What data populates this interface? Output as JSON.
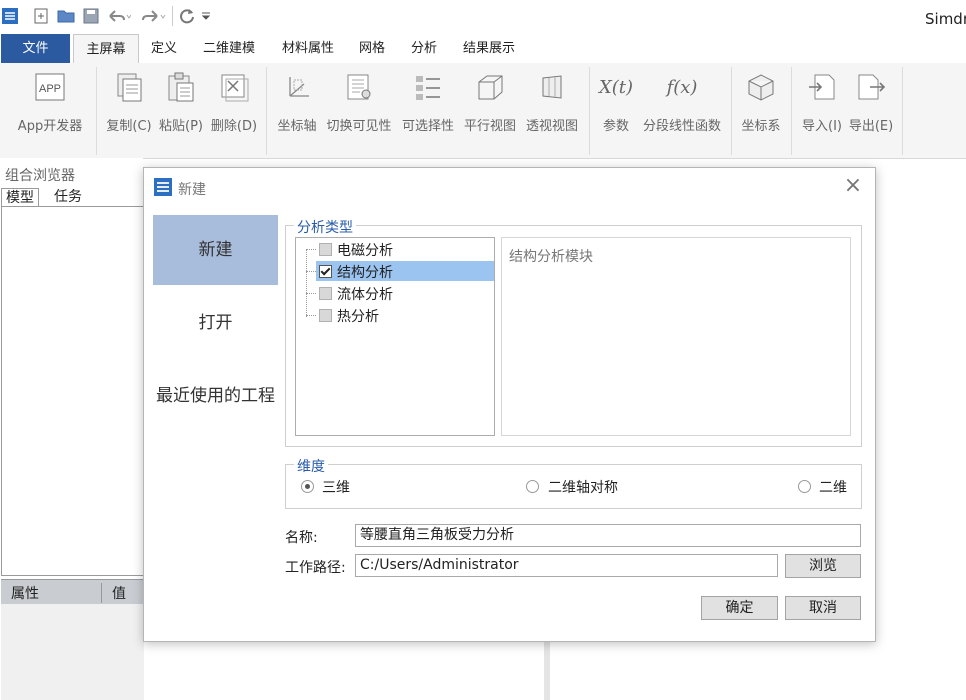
{
  "app": {
    "title": "Simdroid"
  },
  "tabs": {
    "file": "文件",
    "home": "主屏幕",
    "define": "定义",
    "model2d": "二维建模",
    "material": "材料属性",
    "mesh": "网格",
    "analysis": "分析",
    "results": "结果展示"
  },
  "ribbon": {
    "app_icon_text": "APP",
    "app_dev": "App开发器",
    "copy": "复制(C)",
    "paste": "粘贴(P)",
    "delete": "删除(D)",
    "axis": "坐标轴",
    "toggle_visibility": "切换可见性",
    "selectability": "可选择性",
    "parallel_view": "平行视图",
    "perspective_view": "透视视图",
    "param_icon_text": "X(t)",
    "parameters": "参数",
    "func_icon_text": "f(x)",
    "piecewise_func": "分段线性函数",
    "coord_system": "坐标系",
    "import": "导入(I)",
    "export": "导出(E)"
  },
  "left_panel": {
    "title": "组合浏览器",
    "tab_model": "模型",
    "tab_task": "任务",
    "prop_col_attr": "属性",
    "prop_col_value": "值"
  },
  "dialog": {
    "title": "新建",
    "nav": {
      "new": "新建",
      "open": "打开",
      "recent": "最近使用的工程"
    },
    "analysis_type": {
      "title": "分析类型",
      "items": [
        {
          "label": "电磁分析",
          "checked": false
        },
        {
          "label": "结构分析",
          "checked": true
        },
        {
          "label": "流体分析",
          "checked": false
        },
        {
          "label": "热分析",
          "checked": false
        }
      ],
      "description": "结构分析模块"
    },
    "dimension": {
      "title": "维度",
      "options": [
        {
          "label": "三维",
          "selected": true
        },
        {
          "label": "二维轴对称",
          "selected": false
        },
        {
          "label": "二维",
          "selected": false
        }
      ]
    },
    "name_label": "名称:",
    "name_value": "等腰直角三角板受力分析",
    "path_label": "工作路径:",
    "path_value": "C:/Users/Administrator",
    "browse": "浏览",
    "ok": "确定",
    "cancel": "取消"
  },
  "colors": {
    "accent": "#2c5aa0",
    "nav_selected": "#a8bcdc",
    "tree_selected": "#9cc4f0",
    "group_title": "#2a5caa"
  }
}
